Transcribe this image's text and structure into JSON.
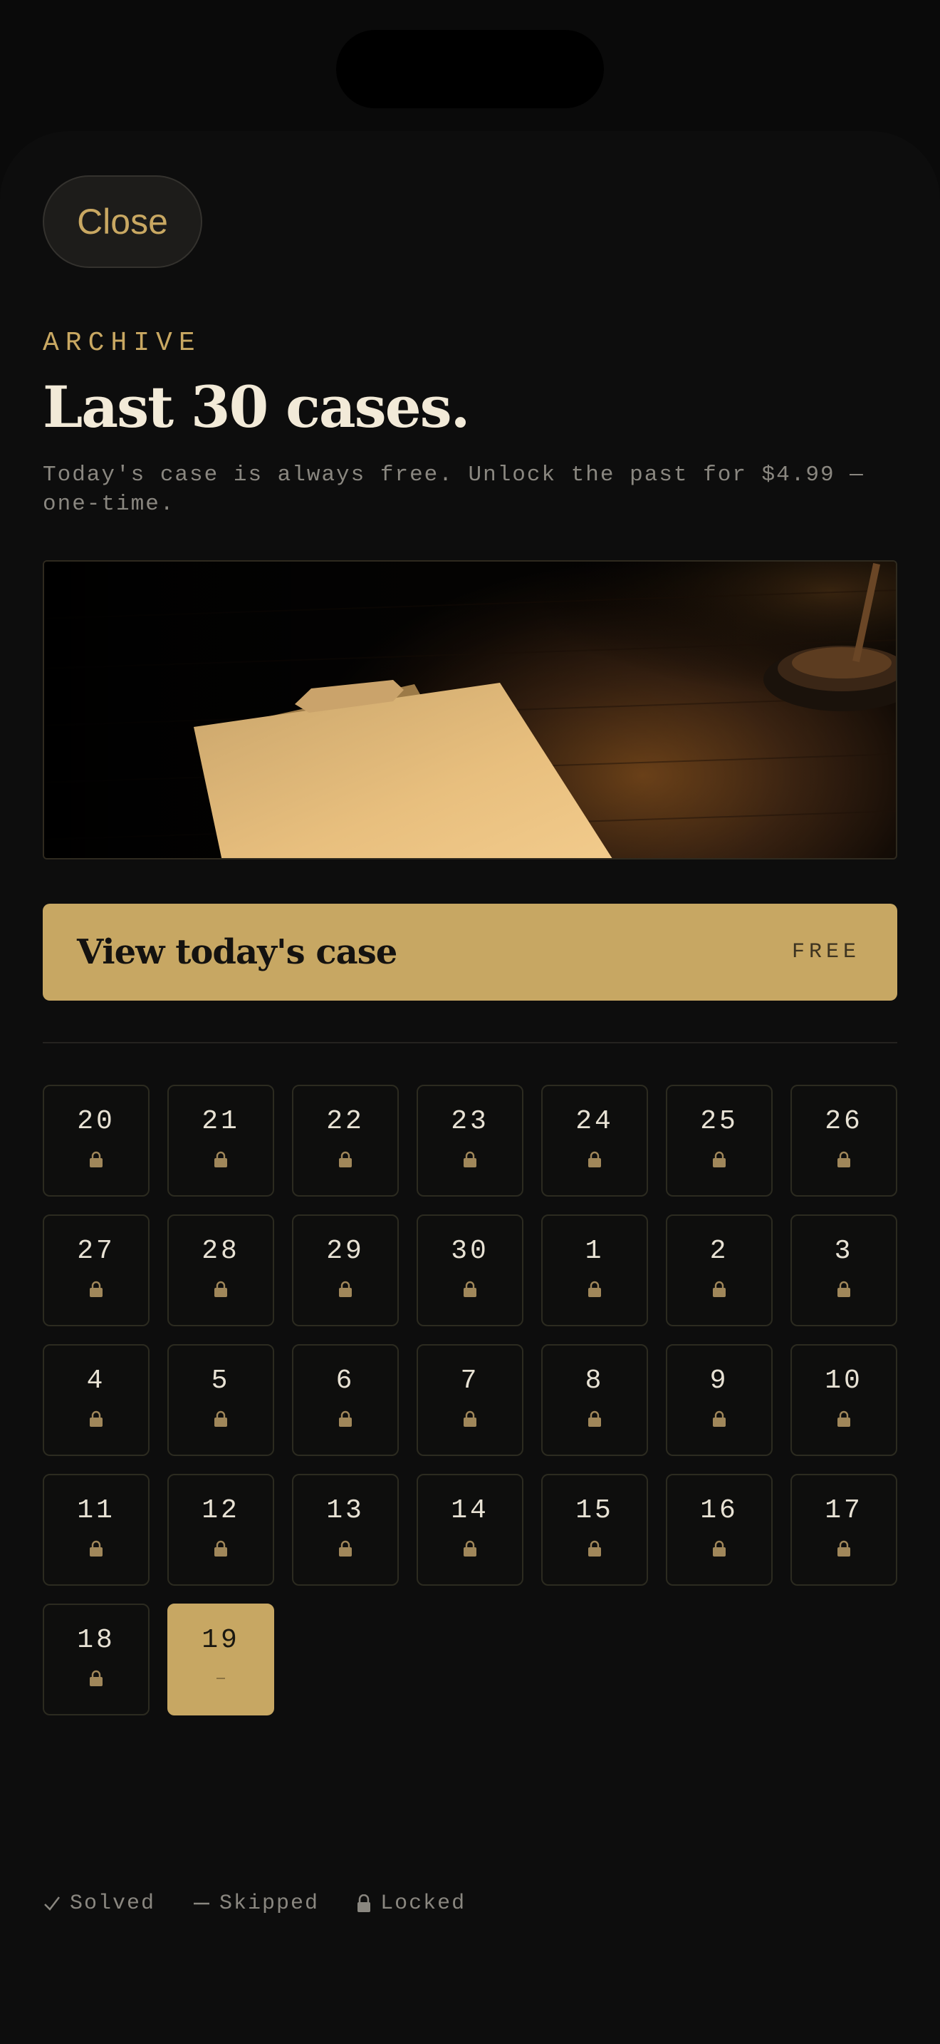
{
  "header": {
    "close_label": "Close",
    "eyebrow": "ARCHIVE",
    "title": "Last 30 cases.",
    "subtitle": "Today's case is always free. Unlock the past for $4.99 — one-time."
  },
  "cta": {
    "label": "View today's case",
    "badge": "FREE"
  },
  "days": [
    {
      "num": "20",
      "status": "locked"
    },
    {
      "num": "21",
      "status": "locked"
    },
    {
      "num": "22",
      "status": "locked"
    },
    {
      "num": "23",
      "status": "locked"
    },
    {
      "num": "24",
      "status": "locked"
    },
    {
      "num": "25",
      "status": "locked"
    },
    {
      "num": "26",
      "status": "locked"
    },
    {
      "num": "27",
      "status": "locked"
    },
    {
      "num": "28",
      "status": "locked"
    },
    {
      "num": "29",
      "status": "locked"
    },
    {
      "num": "30",
      "status": "locked"
    },
    {
      "num": "1",
      "status": "locked"
    },
    {
      "num": "2",
      "status": "locked"
    },
    {
      "num": "3",
      "status": "locked"
    },
    {
      "num": "4",
      "status": "locked"
    },
    {
      "num": "5",
      "status": "locked"
    },
    {
      "num": "6",
      "status": "locked"
    },
    {
      "num": "7",
      "status": "locked"
    },
    {
      "num": "8",
      "status": "locked"
    },
    {
      "num": "9",
      "status": "locked"
    },
    {
      "num": "10",
      "status": "locked"
    },
    {
      "num": "11",
      "status": "locked"
    },
    {
      "num": "12",
      "status": "locked"
    },
    {
      "num": "13",
      "status": "locked"
    },
    {
      "num": "14",
      "status": "locked"
    },
    {
      "num": "15",
      "status": "locked"
    },
    {
      "num": "16",
      "status": "locked"
    },
    {
      "num": "17",
      "status": "locked"
    },
    {
      "num": "18",
      "status": "locked"
    },
    {
      "num": "19",
      "status": "today"
    }
  ],
  "legend": [
    {
      "icon": "check-icon",
      "label": "Solved"
    },
    {
      "icon": "dash-icon",
      "label": "Skipped"
    },
    {
      "icon": "lock-icon",
      "label": "Locked"
    }
  ],
  "colors": {
    "accent": "#c7a763",
    "background": "#0d0d0d",
    "text": "#f2ead8"
  }
}
